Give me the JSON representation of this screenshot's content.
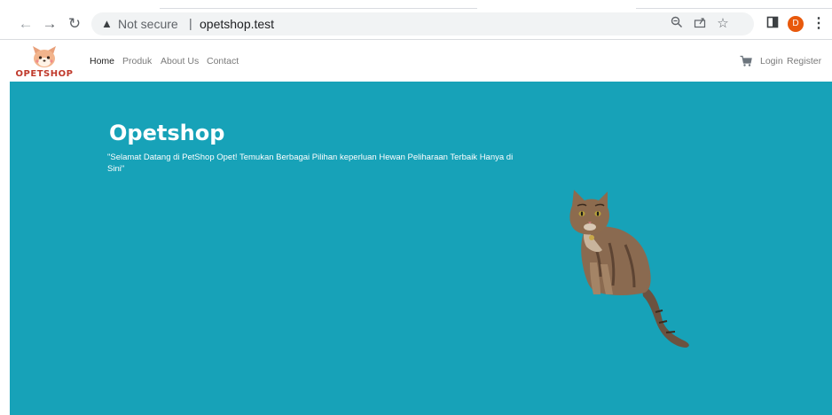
{
  "browser": {
    "back_icon": "arrow-left-icon",
    "forward_icon": "arrow-right-icon",
    "reload_icon": "reload-icon",
    "security_label": "Not secure",
    "separator": "|",
    "url": "opetshop.test",
    "zoom_icon": "zoom-icon",
    "share_icon": "share-icon",
    "bookmark_icon": "star-icon",
    "sidepanel_icon": "side-panel-icon",
    "profile_initial": "D",
    "menu_icon": "more-vert-icon",
    "profile_color": "#e8590c"
  },
  "navbar": {
    "logo_text": "OPETSHOP",
    "links": [
      {
        "label": "Home",
        "active": true
      },
      {
        "label": "Produk",
        "active": false
      },
      {
        "label": "About Us",
        "active": false
      },
      {
        "label": "Contact",
        "active": false
      }
    ],
    "cart_icon": "cart-icon",
    "login_label": "Login",
    "register_label": "Register"
  },
  "hero": {
    "title": "Opetshop",
    "tagline": "\"Selamat Datang di PetShop Opet! Temukan Berbagai Pilihan keperluan Hewan Peliharaan Terbaik Hanya di Sini\"",
    "background_color": "#17a2b8",
    "image": "cat-photo"
  }
}
